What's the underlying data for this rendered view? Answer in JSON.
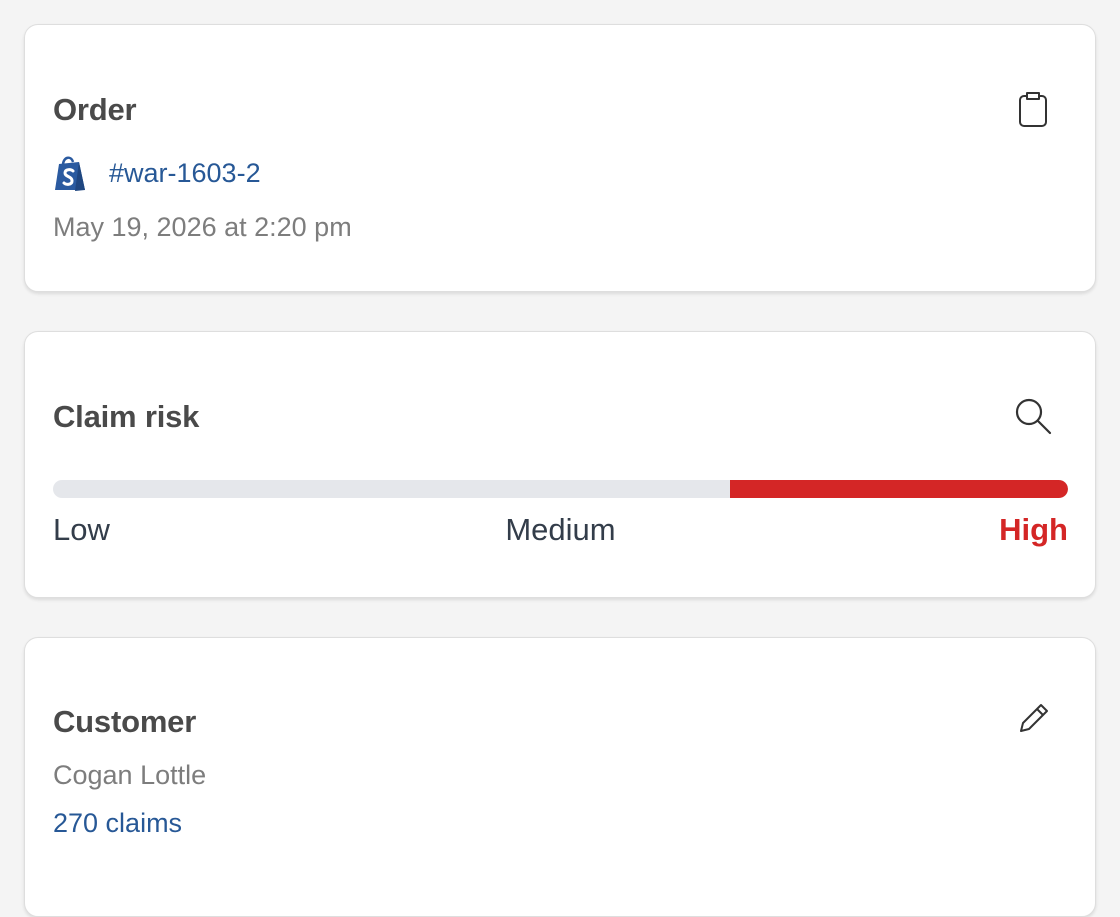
{
  "order": {
    "title": "Order",
    "action_icon": "clipboard-icon",
    "platform_icon": "shopify-icon",
    "order_number": "#war-1603-2",
    "date": "May 19, 2026 at 2:20 pm"
  },
  "claim_risk": {
    "title": "Claim risk",
    "action_icon": "search-icon",
    "level": "High",
    "fill_fraction": 0.333,
    "labels": {
      "low": "Low",
      "medium": "Medium",
      "high": "High"
    },
    "colors": {
      "track": "#e5e7eb",
      "high": "#d42626"
    }
  },
  "customer": {
    "title": "Customer",
    "action_icon": "pencil-icon",
    "name": "Cogan Lottle",
    "claims": "270 claims"
  },
  "colors": {
    "link": "#275896",
    "background": "#f4f4f4"
  }
}
